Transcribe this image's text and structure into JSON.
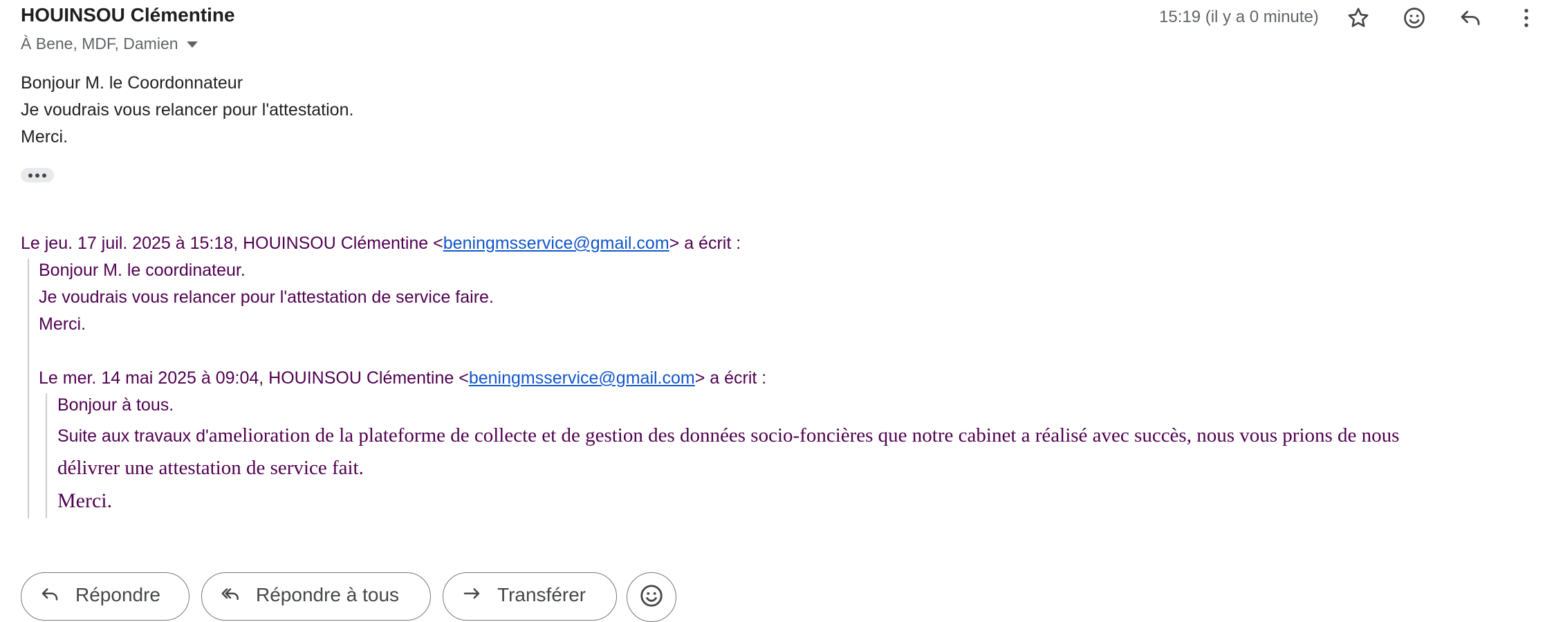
{
  "header": {
    "sender": "HOUINSOU Clémentine",
    "recipients": "À Bene, MDF, Damien",
    "time": "15:19 (il y a 0 minute)"
  },
  "icons": {
    "star": "star-icon",
    "emoji": "emoji-icon",
    "reply": "reply-icon",
    "more": "more-vert-icon"
  },
  "body": {
    "lines": [
      "Bonjour M. le Coordonnateur",
      "Je voudrais vous relancer pour l'attestation.",
      "Merci."
    ]
  },
  "quote1": {
    "attribution_pre": "Le jeu. 17 juil. 2025 à 15:18, HOUINSOU Clémentine <",
    "email": "beningmsservice@gmail.com",
    "attribution_post": "> a écrit :",
    "lines": [
      "Bonjour M. le coordinateur.",
      "Je voudrais vous relancer pour l'attestation de service faire.",
      "Merci."
    ]
  },
  "quote2": {
    "attribution_pre": "Le mer. 14 mai 2025 à 09:04, HOUINSOU Clémentine <",
    "email": "beningmsservice@gmail.com",
    "attribution_post": "> a écrit :",
    "greeting": "Bonjour à tous.",
    "para_prefix": "Suite aux travaux d'",
    "para_rest": "amelioration de la plateforme de collecte et de gestion des données socio-foncières que notre cabinet a réalisé avec succès, nous vous prions de nous",
    "para_line2": "délivrer une attestation de service fait.",
    "closing": "Merci."
  },
  "actions": {
    "reply": "Répondre",
    "reply_all": "Répondre à tous",
    "forward": "Transférer"
  }
}
